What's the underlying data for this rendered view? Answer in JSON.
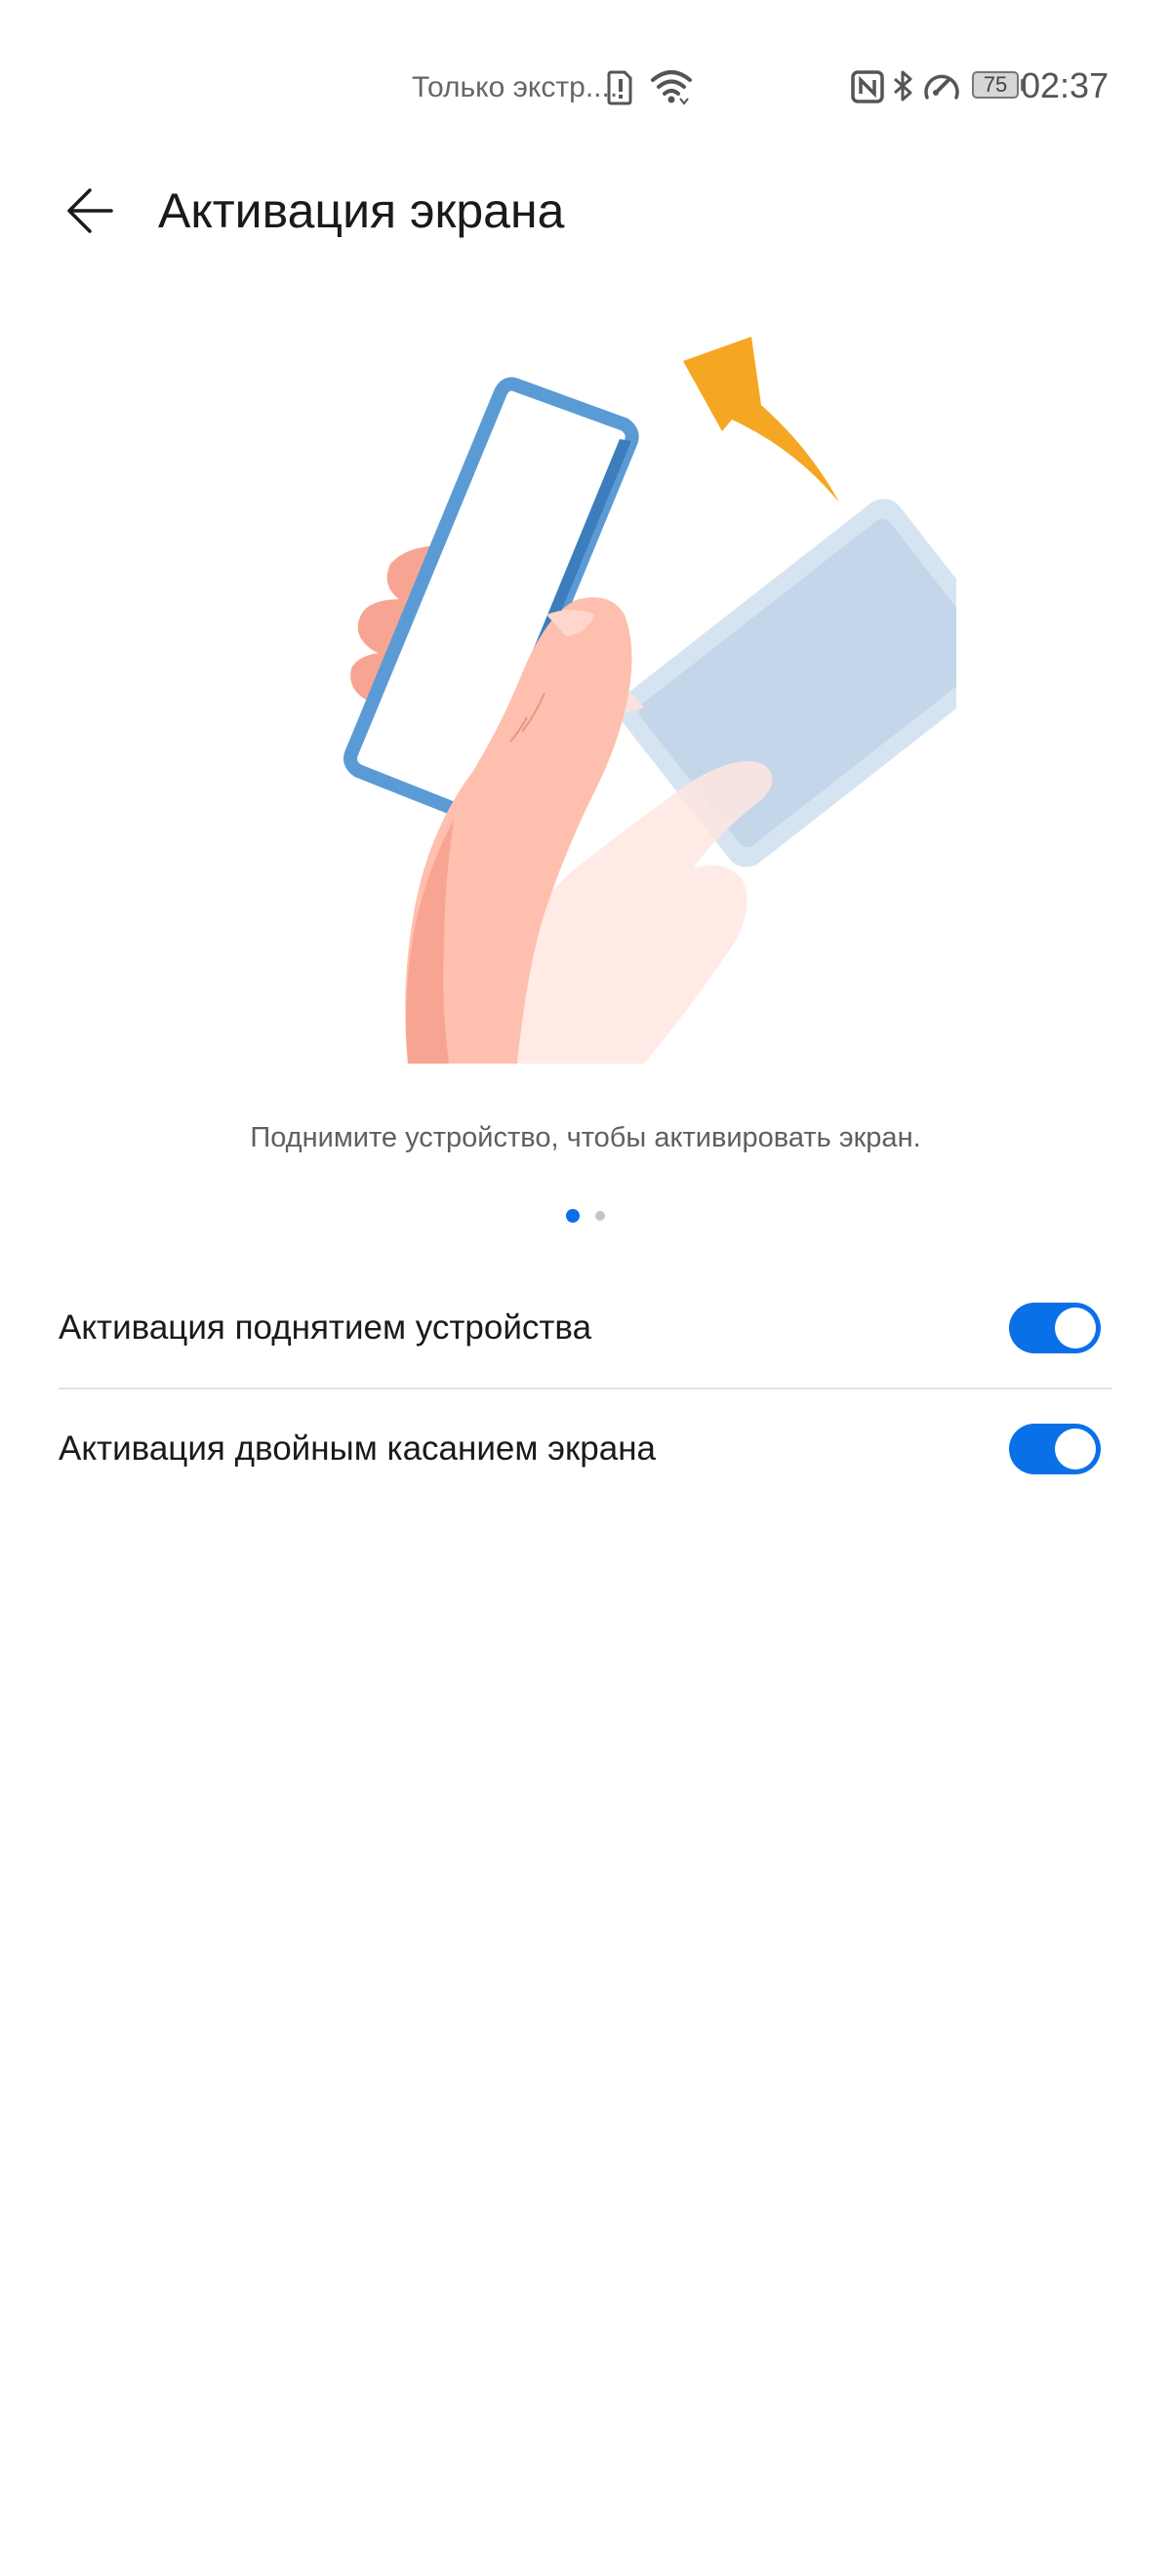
{
  "status_bar": {
    "carrier": "Только экстр....",
    "battery": "75",
    "time": "02:37",
    "icons": [
      "sim-alert-icon",
      "wifi-icon",
      "nfc-icon",
      "bluetooth-icon",
      "speedometer-icon",
      "battery-icon"
    ]
  },
  "header": {
    "back_icon": "arrow-left-icon",
    "title": "Активация экрана"
  },
  "illustration": {
    "description_icon": "raise-to-wake-illustration",
    "colors": {
      "phone_frame": "#5b9bd5",
      "hand": "#ffbfae",
      "hand_shadow": "#f7a592",
      "arrow": "#f5a623",
      "ghost_phone": "#c7d9ec"
    }
  },
  "description": "Поднимите устройство, чтобы активировать экран.",
  "pager": {
    "current": 1,
    "total": 2
  },
  "settings": [
    {
      "label": "Активация поднятием устройства",
      "enabled": true
    },
    {
      "label": "Активация двойным касанием экрана",
      "enabled": true
    }
  ],
  "colors": {
    "accent": "#0a70e8",
    "divider": "#e3e3e3"
  }
}
